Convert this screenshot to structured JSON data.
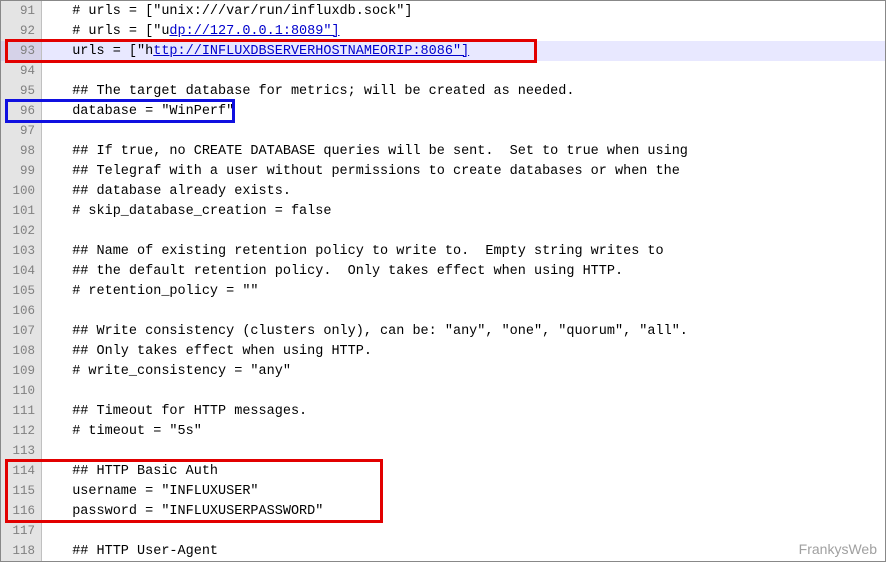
{
  "watermark": "FrankysWeb",
  "lines": [
    {
      "num": 91,
      "text": "  # urls = [\"unix:///var/run/influxdb.sock\"]",
      "link_start": null
    },
    {
      "num": 92,
      "text": "  # urls = [\"udp://127.0.0.1:8089\"]",
      "link_start": 14,
      "link_end": 36
    },
    {
      "num": 93,
      "text": "  urls = [\"http://INFLUXDBSERVERHOSTNAMEORIP:8086\"]",
      "link_start": 12,
      "link_end": 51,
      "hl": true
    },
    {
      "num": 94,
      "text": "",
      "link_start": null
    },
    {
      "num": 95,
      "text": "  ## The target database for metrics; will be created as needed.",
      "link_start": null
    },
    {
      "num": 96,
      "text": "  database = \"WinPerf\"",
      "link_start": null
    },
    {
      "num": 97,
      "text": "",
      "link_start": null
    },
    {
      "num": 98,
      "text": "  ## If true, no CREATE DATABASE queries will be sent.  Set to true when using",
      "link_start": null
    },
    {
      "num": 99,
      "text": "  ## Telegraf with a user without permissions to create databases or when the",
      "link_start": null
    },
    {
      "num": 100,
      "text": "  ## database already exists.",
      "link_start": null
    },
    {
      "num": 101,
      "text": "  # skip_database_creation = false",
      "link_start": null
    },
    {
      "num": 102,
      "text": "",
      "link_start": null
    },
    {
      "num": 103,
      "text": "  ## Name of existing retention policy to write to.  Empty string writes to",
      "link_start": null
    },
    {
      "num": 104,
      "text": "  ## the default retention policy.  Only takes effect when using HTTP.",
      "link_start": null
    },
    {
      "num": 105,
      "text": "  # retention_policy = \"\"",
      "link_start": null
    },
    {
      "num": 106,
      "text": "",
      "link_start": null
    },
    {
      "num": 107,
      "text": "  ## Write consistency (clusters only), can be: \"any\", \"one\", \"quorum\", \"all\".",
      "link_start": null
    },
    {
      "num": 108,
      "text": "  ## Only takes effect when using HTTP.",
      "link_start": null
    },
    {
      "num": 109,
      "text": "  # write_consistency = \"any\"",
      "link_start": null
    },
    {
      "num": 110,
      "text": "",
      "link_start": null
    },
    {
      "num": 111,
      "text": "  ## Timeout for HTTP messages.",
      "link_start": null
    },
    {
      "num": 112,
      "text": "  # timeout = \"5s\"",
      "link_start": null
    },
    {
      "num": 113,
      "text": "",
      "link_start": null
    },
    {
      "num": 114,
      "text": "  ## HTTP Basic Auth",
      "link_start": null
    },
    {
      "num": 115,
      "text": "  username = \"INFLUXUSER\"",
      "link_start": null
    },
    {
      "num": 116,
      "text": "  password = \"INFLUXUSERPASSWORD\"",
      "link_start": null
    },
    {
      "num": 117,
      "text": "",
      "link_start": null
    },
    {
      "num": 118,
      "text": "  ## HTTP User-Agent",
      "link_start": null
    }
  ]
}
